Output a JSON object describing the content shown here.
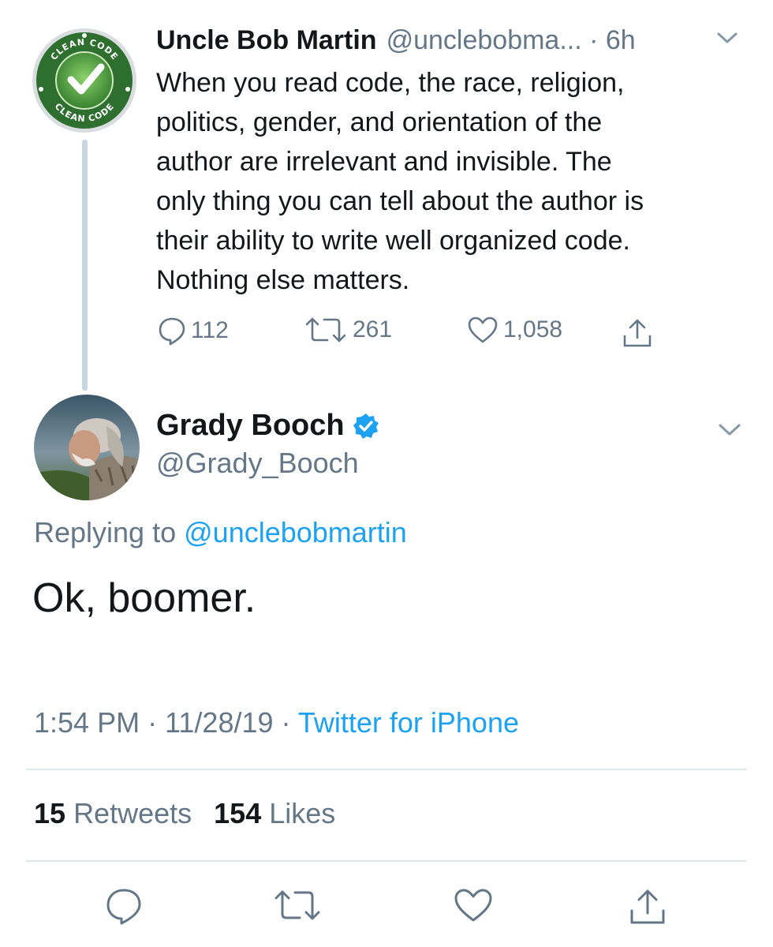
{
  "original_tweet": {
    "avatar": {
      "badge_text_top": "CLEAN CODE",
      "badge_text_bottom": "CLEAN CODE",
      "icon": "checkmark-icon"
    },
    "author_name": "Uncle Bob Martin",
    "handle_time": "@unclebobma... · 6h",
    "text_lines": [
      "When you read code, the race, religion,",
      "politics, gender, and orientation of the",
      "author are irrelevant and invisible. The",
      "only thing you can tell about the author is",
      "their ability to write well organized code.",
      "Nothing else matters."
    ],
    "actions": {
      "replies": "112",
      "retweets": "261",
      "likes": "1,058"
    }
  },
  "reply_tweet": {
    "author_name": "Grady Booch",
    "handle": "@Grady_Booch",
    "replying_prefix": "Replying to",
    "replying_to": "@unclebobmartin",
    "text": "Ok, boomer.",
    "time": "1:54 PM · 11/28/19 · ",
    "source": "Twitter for iPhone",
    "stats": {
      "retweets_count": "15",
      "retweets_label": "Retweets",
      "likes_count": "154",
      "likes_label": "Likes"
    }
  },
  "colors": {
    "accent": "#1da1f2",
    "muted": "#657786",
    "text": "#14171a",
    "divider": "#e1e8ed",
    "badge_green": "#2e7d32"
  }
}
